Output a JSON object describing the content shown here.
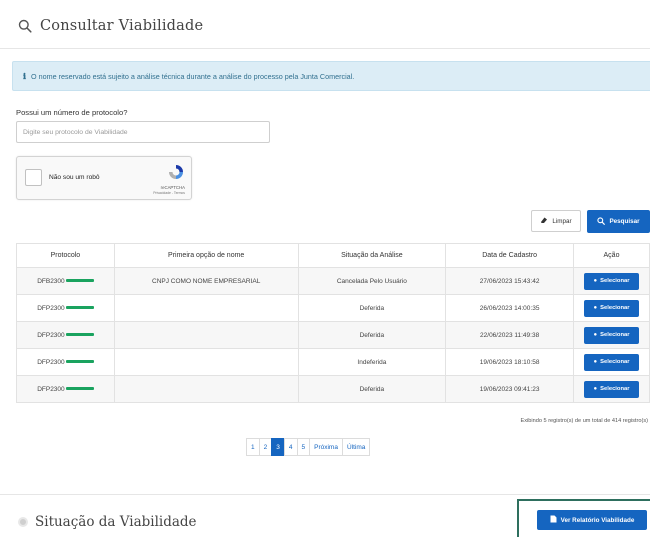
{
  "header": {
    "title": "Consultar Viabilidade",
    "icon": "search-icon"
  },
  "alert": {
    "message": "O nome reservado está sujeito a análise técnica durante a análise do processo pela Junta Comercial.",
    "color": "#31708f"
  },
  "protocol": {
    "label": "Possui um número de protocolo?",
    "placeholder": "Digite seu protocolo de Viabilidade",
    "value": ""
  },
  "captcha": {
    "label": "Não sou um robô",
    "brand": "reCAPTCHA",
    "links": "Privacidade - Termos"
  },
  "buttons": {
    "clear": "Limpar",
    "search": "Pesquisar"
  },
  "table": {
    "headers": [
      "Protocolo",
      "Primeira opção de nome",
      "Situação da Análise",
      "Data de Cadastro",
      "Ação"
    ],
    "rows": [
      {
        "protocol": "DFB2300",
        "name": "CNPJ COMO NOME EMPRESARIAL",
        "status": "Cancelada Pelo Usuário",
        "date": "27/06/2023 15:43:42",
        "action": "Selecionar"
      },
      {
        "protocol": "DFP2300",
        "name": "",
        "status": "Deferida",
        "date": "26/06/2023 14:00:35",
        "action": "Selecionar"
      },
      {
        "protocol": "DFP2300",
        "name": "",
        "status": "Deferida",
        "date": "22/06/2023 11:49:38",
        "action": "Selecionar"
      },
      {
        "protocol": "DFP2300",
        "name": "",
        "status": "Indeferida",
        "date": "19/06/2023 18:10:58",
        "action": "Selecionar"
      },
      {
        "protocol": "DFP2300",
        "name": "",
        "status": "Deferida",
        "date": "19/06/2023 09:41:23",
        "action": "Selecionar"
      }
    ]
  },
  "summary": "Exibindo 5 registro(s) de um total de 414 registro(s)",
  "pagination": {
    "pages": [
      "1",
      "2",
      "3",
      "4",
      "5"
    ],
    "current": "3",
    "next": "Próxima",
    "last": "Última"
  },
  "footer": {
    "title": "Situação da Viabilidade",
    "report_button": "Ver Relatório Viabilidade"
  },
  "colors": {
    "primary": "#1565c0",
    "alert_bg": "#dcedf6",
    "redaction": "#1aa35f",
    "highlight_frame": "#2e6f5e"
  }
}
